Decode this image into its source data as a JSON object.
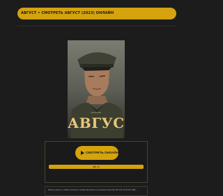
{
  "header": {
    "title": "АВГУСТ • СМОТРЕТЬ АВГУСТ (2023) ОНЛАЙН"
  },
  "poster": {
    "subtitle": "ОНЛАЙН",
    "title": "АВГУСТ"
  },
  "player": {
    "watch_label": "СМОТРЕТЬ ОНЛАЙН",
    "progress_label": "18 / 2"
  },
  "description": {
    "text": "Фильм «Август» (2023) смотреть онлайн бесплатно в хорошем качестве HD 720 и Full HD 1080 ..."
  },
  "colors": {
    "accent": "#d4a30e",
    "background": "#1c1c1c"
  }
}
